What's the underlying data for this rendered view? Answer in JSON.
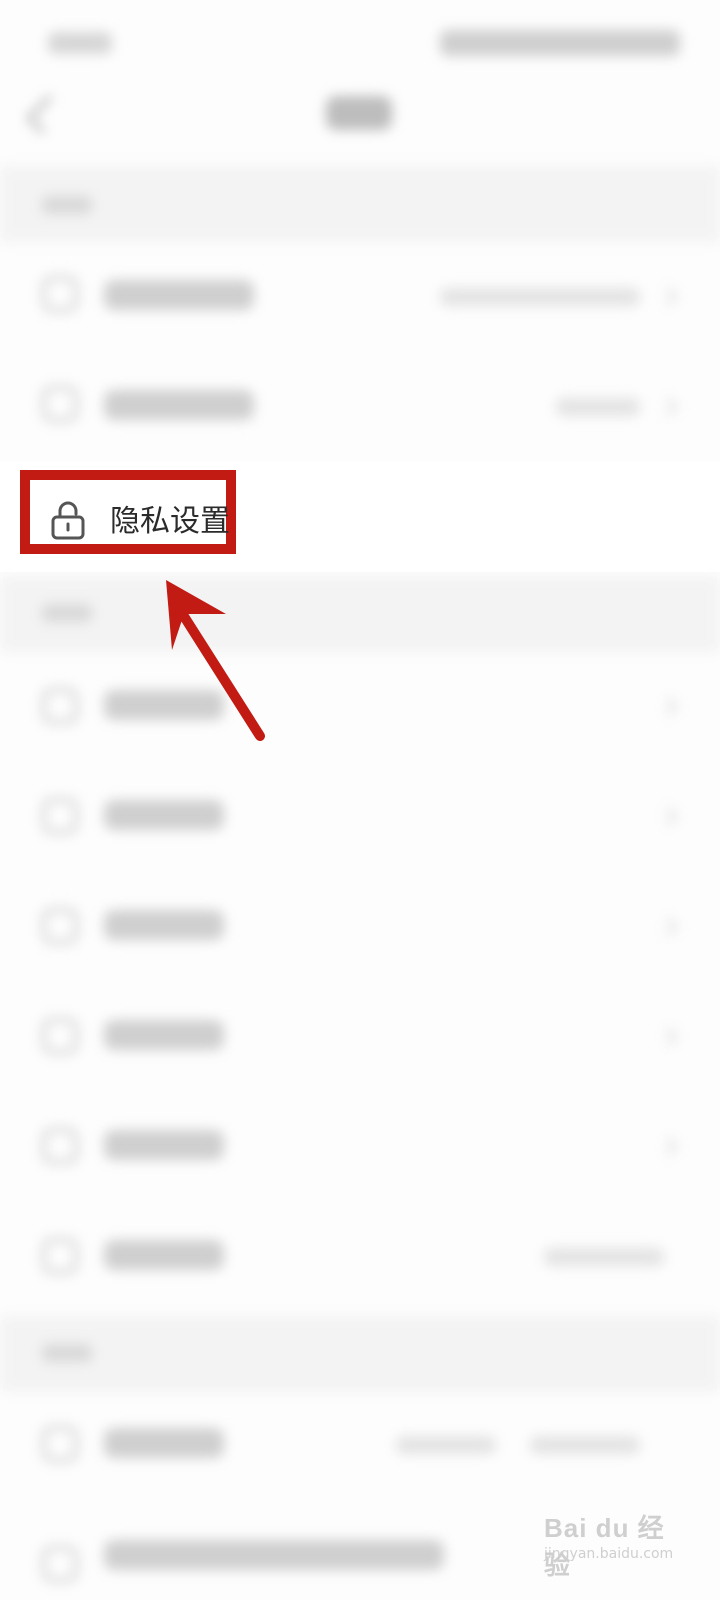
{
  "menu": {
    "privacy_label": "隐私设置",
    "privacy_icon": "lock-icon"
  },
  "annotation": {
    "highlight_color": "#c11b14",
    "arrow_color": "#c11b14"
  },
  "watermark": {
    "brand": "Bai du 经验",
    "url": "jingyan.baidu.com"
  }
}
